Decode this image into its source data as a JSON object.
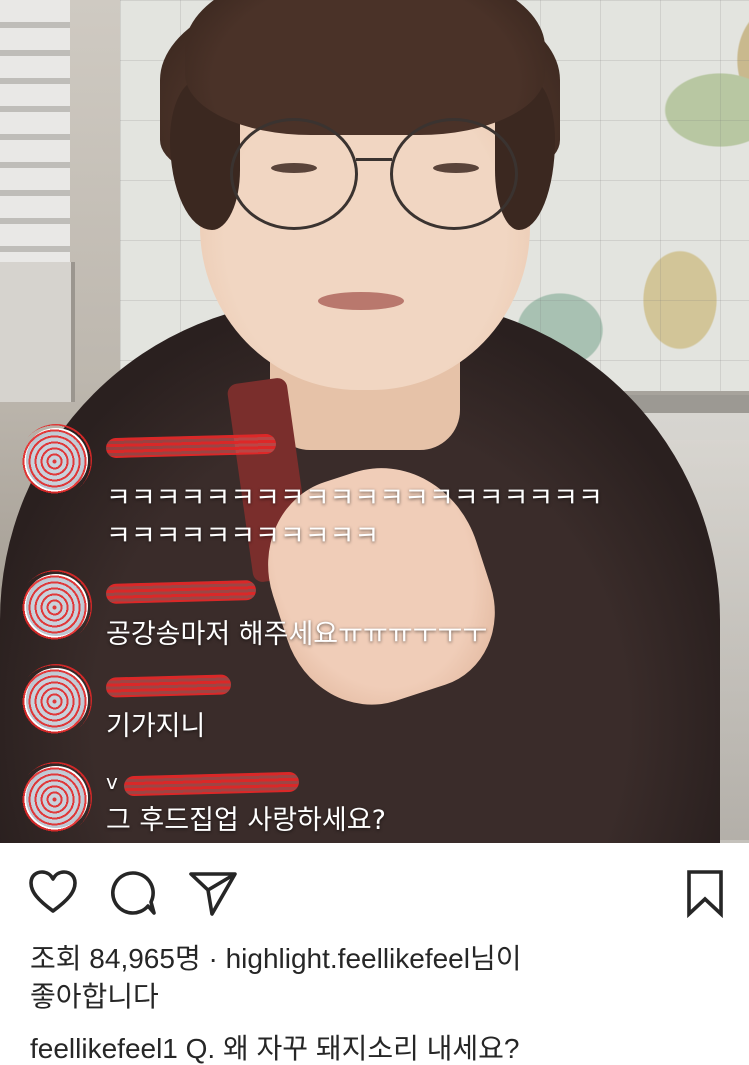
{
  "comments": [
    {
      "username": "",
      "text_lines": [
        "ㅋㅋㅋㅋㅋㅋㅋㅋㅋㅋㅋㅋㅋㅋㅋㅋㅋㅋㅋㅋ",
        "ㅋㅋㅋㅋㅋㅋㅋㅋㅋㅋㅋ"
      ]
    },
    {
      "username": "",
      "text_lines": [
        "공강송마저 해주세요ㅠㅠㅠㅜㅜㅜ"
      ]
    },
    {
      "username": "",
      "text_lines": [
        "기가지니"
      ]
    },
    {
      "username": "v",
      "text_lines": [
        "그 후드집업 사랑하세요?"
      ]
    }
  ],
  "actions": {
    "like_icon": "heart-outline",
    "comment_icon": "speech-bubble",
    "share_icon": "paper-plane",
    "save_icon": "bookmark"
  },
  "stats": {
    "views_prefix": "조회 84,965명",
    "separator": " · ",
    "liker": "highlight.feellikefeel",
    "liker_suffix": "님이",
    "liked_text": "좋아합니다"
  },
  "caption": {
    "owner": "feellikefeel1",
    "text": "Q. 왜 자꾸 돼지소리 내세요?"
  }
}
